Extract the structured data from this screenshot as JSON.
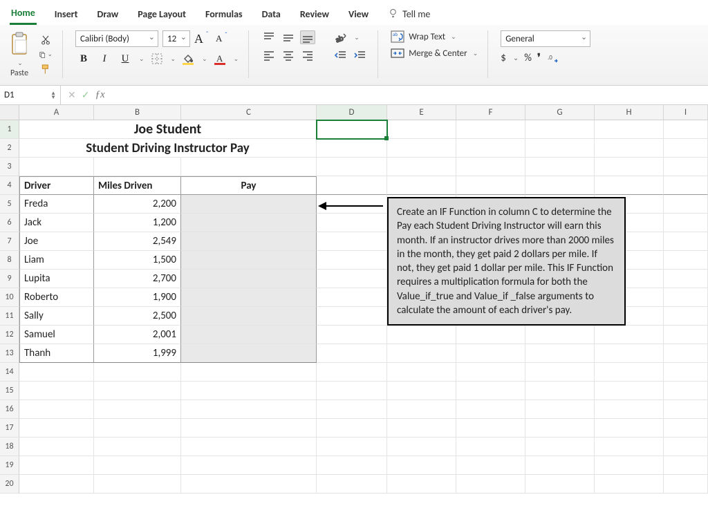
{
  "tabs": {
    "home": "Home",
    "insert": "Insert",
    "draw": "Draw",
    "pagelayout": "Page Layout",
    "formulas": "Formulas",
    "data": "Data",
    "review": "Review",
    "view": "View",
    "tellme": "Tell me"
  },
  "ribbon": {
    "paste_label": "Paste",
    "font_name": "Calibri (Body)",
    "font_size": "12",
    "wrap_text": "Wrap Text",
    "merge_center": "Merge & Center",
    "number_format": "General",
    "currency_symbol": "$",
    "percent_symbol": "%",
    "comma_symbol": ","
  },
  "formula_bar": {
    "cell_ref": "D1",
    "formula": ""
  },
  "columns": [
    "A",
    "B",
    "C",
    "D",
    "E",
    "F",
    "G",
    "H",
    "I"
  ],
  "row_numbers": [
    1,
    2,
    3,
    4,
    5,
    6,
    7,
    8,
    9,
    10,
    11,
    12,
    13,
    14,
    15,
    16,
    17,
    18,
    19,
    20
  ],
  "title1": "Joe Student",
  "title2": "Student Driving Instructor Pay",
  "headers": {
    "a": "Driver",
    "b": "Miles Driven",
    "c": "Pay"
  },
  "data_rows": [
    {
      "driver": "Freda",
      "miles": "2,200"
    },
    {
      "driver": "Jack",
      "miles": "1,200"
    },
    {
      "driver": "Joe",
      "miles": "2,549"
    },
    {
      "driver": "Liam",
      "miles": "1,500"
    },
    {
      "driver": "Lupita",
      "miles": "2,700"
    },
    {
      "driver": "Roberto",
      "miles": "1,900"
    },
    {
      "driver": "Sally",
      "miles": "2,500"
    },
    {
      "driver": "Samuel",
      "miles": "2,001"
    },
    {
      "driver": "Thanh",
      "miles": "1,999"
    }
  ],
  "instruction_text": "Create an IF Function in column C to determine the Pay each Student Driving Instructor will earn this month. If an instructor drives more than 2000 miles in the month, they get paid 2 dollars per mile. If not, they get paid 1 dollar per mile. This IF Function requires a multiplication formula for both the Value_if_true and Value_if _false arguments to calculate the amount of each driver's pay."
}
